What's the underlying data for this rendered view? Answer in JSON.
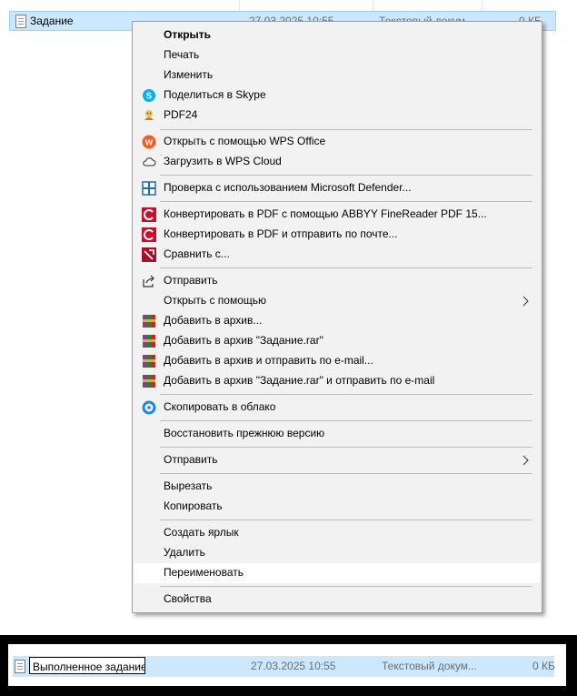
{
  "explorer_top": {
    "file_name": "Задание",
    "date": "27.03.2025 10:55",
    "type": "Текстовый докум...",
    "size": "0 КБ"
  },
  "context_menu": {
    "open": "Открыть",
    "print": "Печать",
    "edit": "Изменить",
    "share_skype": "Поделиться в Skype",
    "pdf24": "PDF24",
    "open_wps": "Открыть с помощью WPS Office",
    "upload_wps_cloud": "Загрузить в WPS Cloud",
    "defender_scan": "Проверка с использованием Microsoft Defender...",
    "abbyy_convert": "Конвертировать в PDF с помощью ABBYY FineReader PDF 15...",
    "abbyy_convert_mail": "Конвертировать в PDF и отправить по почте...",
    "abbyy_compare": "Сравнить с...",
    "send_share": "Отправить",
    "open_with": "Открыть с помощью",
    "rar_add": "Добавить в архив...",
    "rar_add_named": "Добавить в архив \"Задание.rar\"",
    "rar_add_email": "Добавить в архив и отправить по e-mail...",
    "rar_add_named_email": "Добавить в архив \"Задание.rar\" и отправить по e-mail",
    "copy_to_cloud": "Скопировать в облако",
    "restore_version": "Восстановить прежнюю версию",
    "send_to": "Отправить",
    "cut": "Вырезать",
    "copy": "Копировать",
    "create_shortcut": "Создать ярлык",
    "delete": "Удалить",
    "rename": "Переименовать",
    "properties": "Свойства"
  },
  "explorer_bottom": {
    "rename_value": "Выполненное задание",
    "date": "27.03.2025 10:55",
    "type": "Текстовый докум...",
    "size": "0 КБ"
  },
  "colors": {
    "selection": "#cce8ff",
    "menu_background": "#f2f2f2",
    "hover": "#ffffff",
    "abbyy_red": "#c8102e",
    "wps_orange": "#ff5722",
    "skype_blue": "#00aff0",
    "defender_blue": "#1f6fa8"
  },
  "icons": {
    "file": "text-file-icon",
    "skype": "skype-icon",
    "pdf24": "pdf24-icon",
    "wps": "wps-office-icon",
    "cloud": "cloud-icon",
    "defender": "defender-shield-icon",
    "abbyy": "abbyy-icon",
    "abbyy_compare": "abbyy-compare-icon",
    "share": "share-icon",
    "winrar": "winrar-icon",
    "cloud_copy": "cloud-copy-icon",
    "submenu": "chevron-right-icon"
  }
}
